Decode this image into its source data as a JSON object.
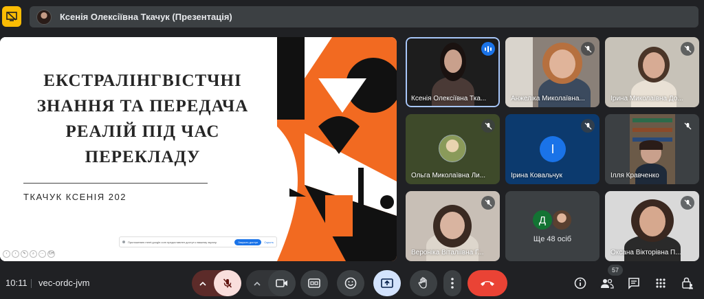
{
  "presenter": {
    "title": "Ксенія Олексіївна Ткачук (Презентація)"
  },
  "slide": {
    "title_lines": [
      "ЕКСТРАЛІНГВІСТЧНІ",
      "ЗНАННЯ ТА ПЕРЕДАЧА",
      "РЕАЛІЙ ПІД ЧАС",
      "ПЕРЕКЛАДУ"
    ],
    "subtitle": "ТКАЧУК КСЕНІЯ 202",
    "share_notice": "Приложению meet.google.com предоставлен доступ к вашему экрану.",
    "share_button": "Закрыть доступ",
    "share_hide": "Скрыть",
    "toolbar_badge": "CH"
  },
  "participants": [
    {
      "name": "Ксенія Олексіївна Тка...",
      "state": "speaking"
    },
    {
      "name": "Анжеліка Миколаївна...",
      "state": "muted"
    },
    {
      "name": "Ірина Миколаївна До...",
      "state": "muted"
    },
    {
      "name": "Ольга Миколаївна Ли...",
      "state": "muted"
    },
    {
      "name": "Ірина Ковальчук",
      "state": "muted",
      "initial": "І"
    },
    {
      "name": "Ілля Кравченко",
      "state": "muted"
    },
    {
      "name": "Вероніка Віталіївна Г...",
      "state": "muted"
    },
    {
      "name": "Ще 48 осіб",
      "state": "overflow",
      "initial": "Д"
    },
    {
      "name": "Оксана Вікторівна П...",
      "state": "muted"
    }
  ],
  "bottom_bar": {
    "time": "10:11",
    "meeting_code": "vec-ordc-jvm",
    "people_count": "57"
  },
  "colors": {
    "accent": "#1a73e8",
    "end_call": "#ea4335",
    "mic_off_bg": "#f9dedc",
    "slide_orange": "#f26a21"
  }
}
